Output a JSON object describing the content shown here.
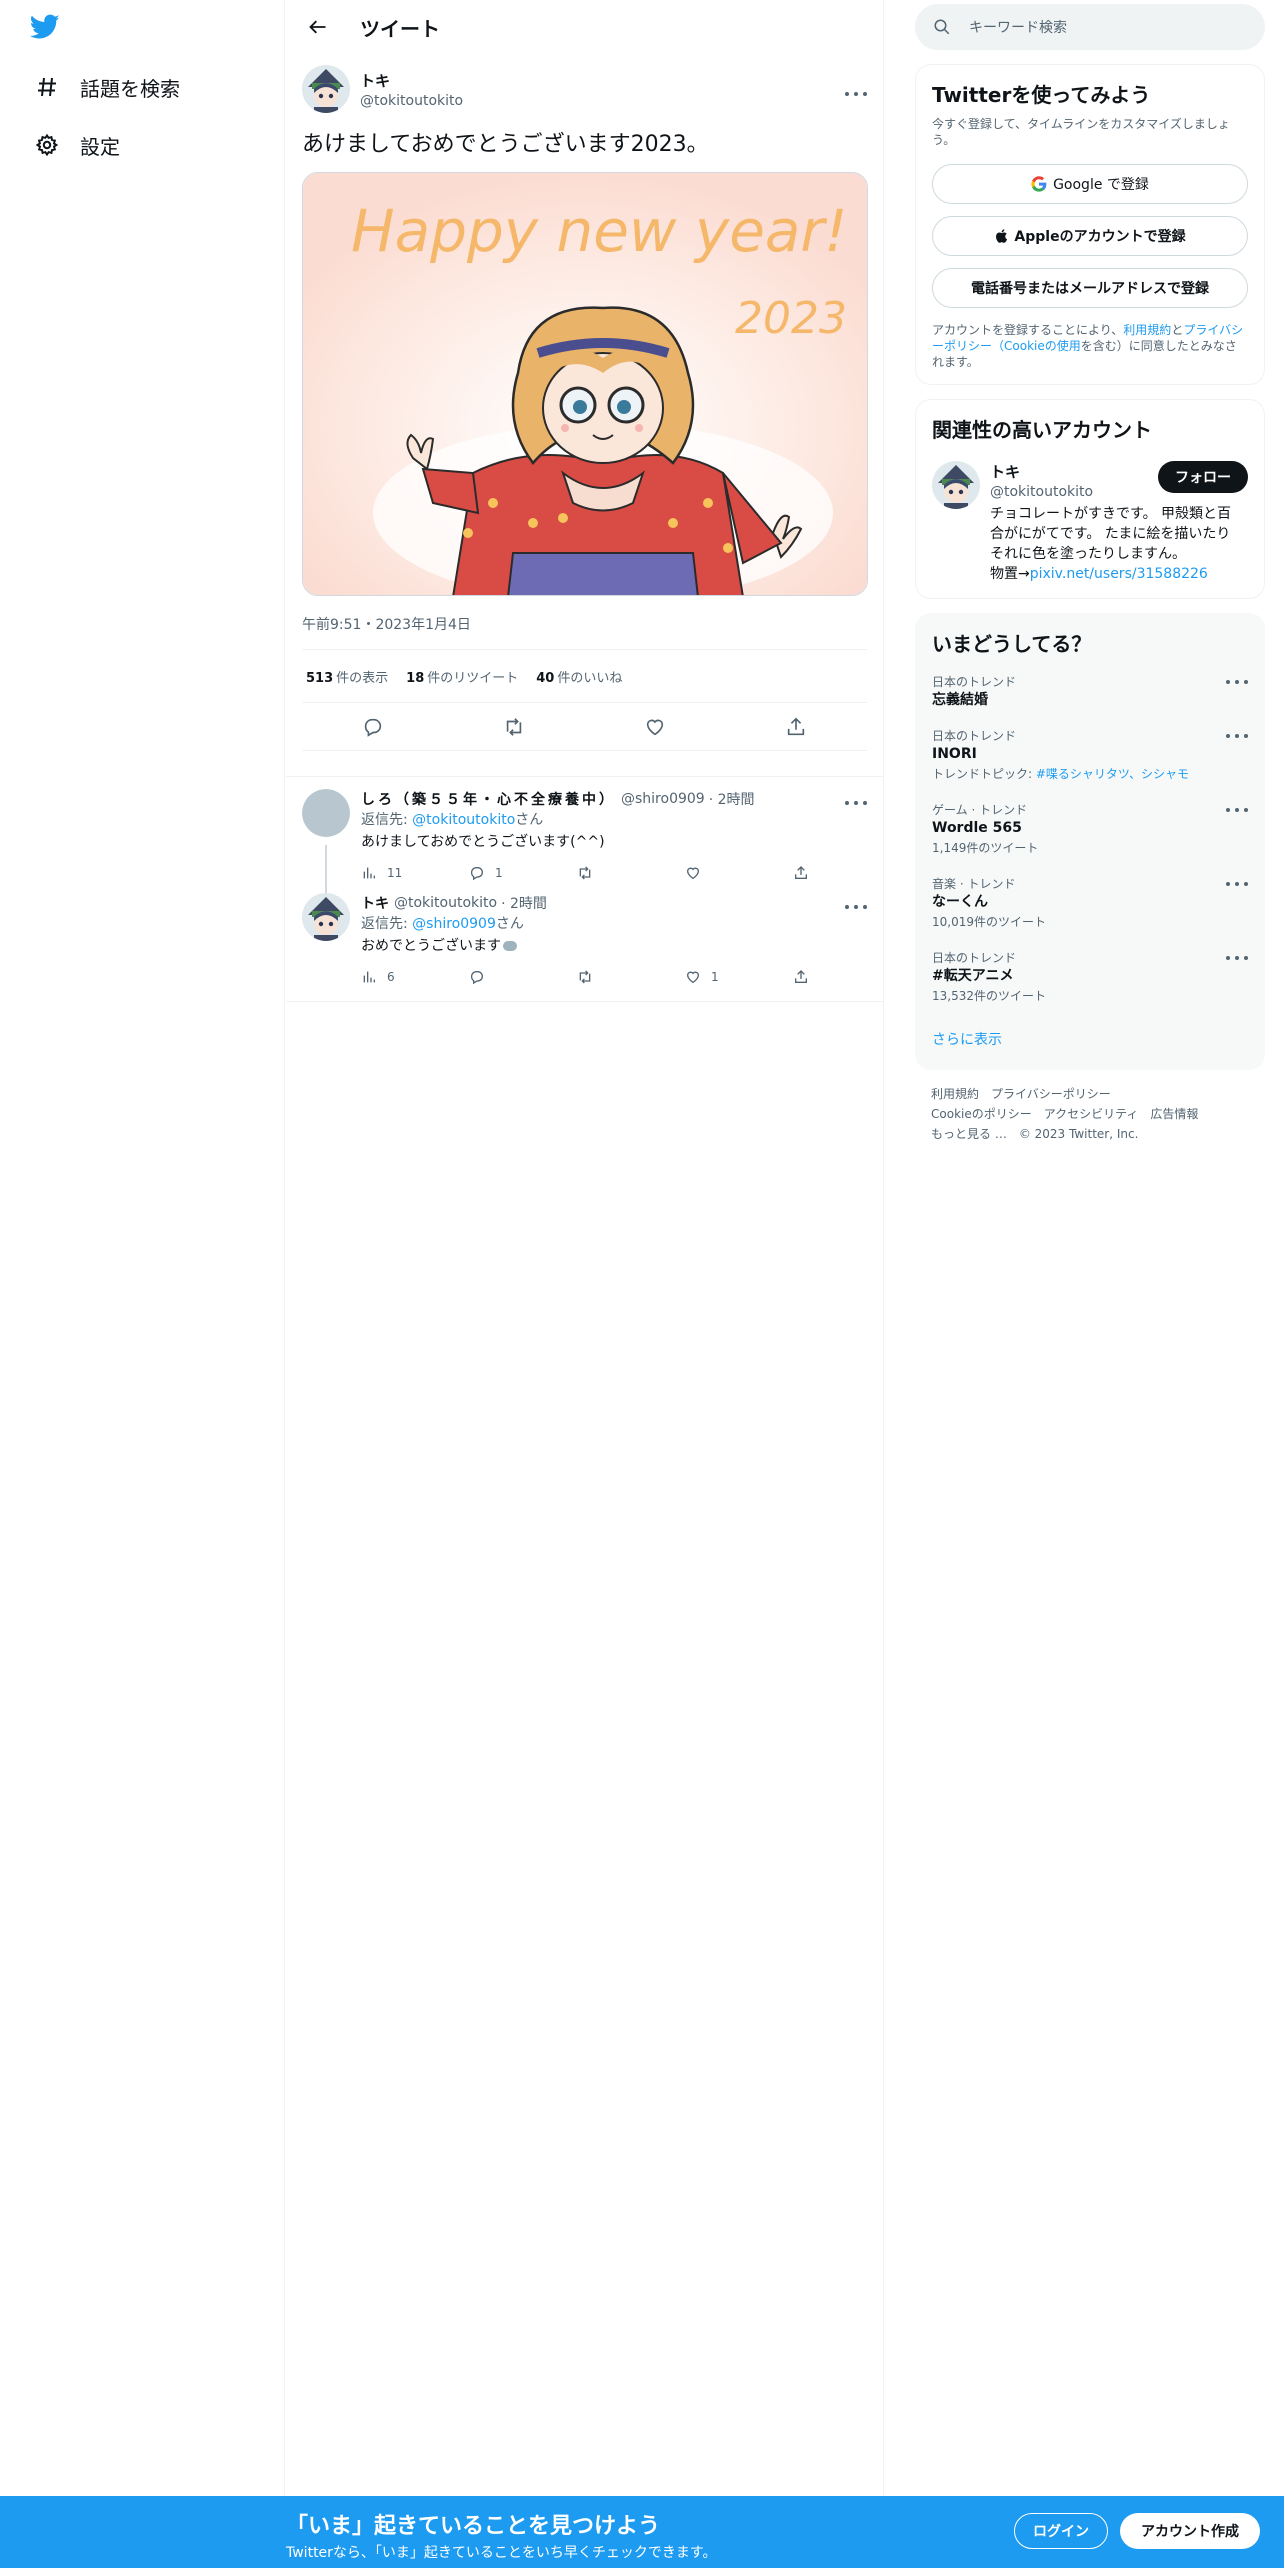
{
  "colors": {
    "accent": "#1d9bf0",
    "text": "#0f1419",
    "muted": "#536471",
    "border": "#eff3f4"
  },
  "sidebar": {
    "logo_icon": "twitter-bird-icon",
    "items": [
      {
        "icon": "hashtag-icon",
        "label": "話題を検索"
      },
      {
        "icon": "gear-icon",
        "label": "設定"
      }
    ]
  },
  "header": {
    "back_icon": "arrow-left-icon",
    "title": "ツイート"
  },
  "tweet": {
    "author_name": "トキ",
    "author_handle": "@tokitoutokito",
    "text": "あけましておめでとうございます2023。",
    "image": {
      "headline": "Happy new year!",
      "year": "2023"
    },
    "time": "午前9:51・2023年1月4日",
    "stats": {
      "views_count": "513",
      "views_label": "件の表示",
      "retweets_count": "18",
      "retweets_label": "件のリツイート",
      "likes_count": "40",
      "likes_label": "件のいいね"
    }
  },
  "replies": [
    {
      "name": "しろ（築５５年・心不全療養中）",
      "handle": "@shiro0909",
      "time": "· 2時間",
      "reply_to_prefix": "返信先: ",
      "reply_to": "@tokitoutokito",
      "reply_to_suffix": "さん",
      "text": "あけましておめでとうございます(^^)",
      "views": "11",
      "replies": "1",
      "retweets": "",
      "likes": ""
    },
    {
      "name": "トキ",
      "handle": "@tokitoutokito",
      "time": "· 2時間",
      "reply_to_prefix": "返信先: ",
      "reply_to": "@shiro0909",
      "reply_to_suffix": "さん",
      "text": "おめでとうございます",
      "views": "6",
      "replies": "",
      "retweets": "",
      "likes": "1"
    }
  ],
  "right": {
    "search_placeholder": "キーワード検索",
    "signup": {
      "title": "Twitterを使ってみよう",
      "subtitle": "今すぐ登録して、タイムラインをカスタマイズしましょう。",
      "google": "Google で登録",
      "apple": "Appleのアカウントで登録",
      "phone": "電話番号またはメールアドレスで登録",
      "terms_1": "アカウントを登録することにより、",
      "terms_link1": "利用規約",
      "terms_2": "と",
      "terms_link2": "プライバシーポリシー（Cookieの使用",
      "terms_3": "を含む）に同意したとみなされます。"
    },
    "related": {
      "title": "関連性の高いアカウント",
      "name": "トキ",
      "handle": "@tokitoutokito",
      "follow": "フォロー",
      "bio": "チョコレートがすきです。 甲殻類と百合がにがてです。 たまに絵を描いたりそれに色を塗ったりしますん。",
      "bio_prefix": "物置→",
      "bio_link": "pixiv.net/users/31588226"
    },
    "trends": {
      "title": "いまどうしてる？",
      "items": [
        {
          "context": "日本のトレンド",
          "name": "忘義結婚",
          "extra": ""
        },
        {
          "context": "日本のトレンド",
          "name": "INORI",
          "extra_prefix": "トレンドトピック: ",
          "extra": "#喋るシャリタツ、シシャモ"
        },
        {
          "context": "ゲーム · トレンド",
          "name": "Wordle 565",
          "extra": "1,149件のツイート"
        },
        {
          "context": "音楽 · トレンド",
          "name": "なーくん",
          "extra": "10,019件のツイート"
        },
        {
          "context": "日本のトレンド",
          "name": "#転天アニメ",
          "extra": "13,532件のツイート"
        }
      ],
      "show_more": "さらに表示"
    },
    "footer": {
      "row1": [
        "利用規約",
        "プライバシーポリシー"
      ],
      "row2": [
        "Cookieのポリシー",
        "アクセシビリティ",
        "広告情報"
      ],
      "row3": [
        "もっと見る …",
        "© 2023 Twitter, Inc."
      ]
    }
  },
  "banner": {
    "title": "「いま」起きていることを見つけよう",
    "subtitle": "Twitterなら、「いま」起きていることをいち早くチェックできます。",
    "login": "ログイン",
    "signup": "アカウント作成"
  }
}
